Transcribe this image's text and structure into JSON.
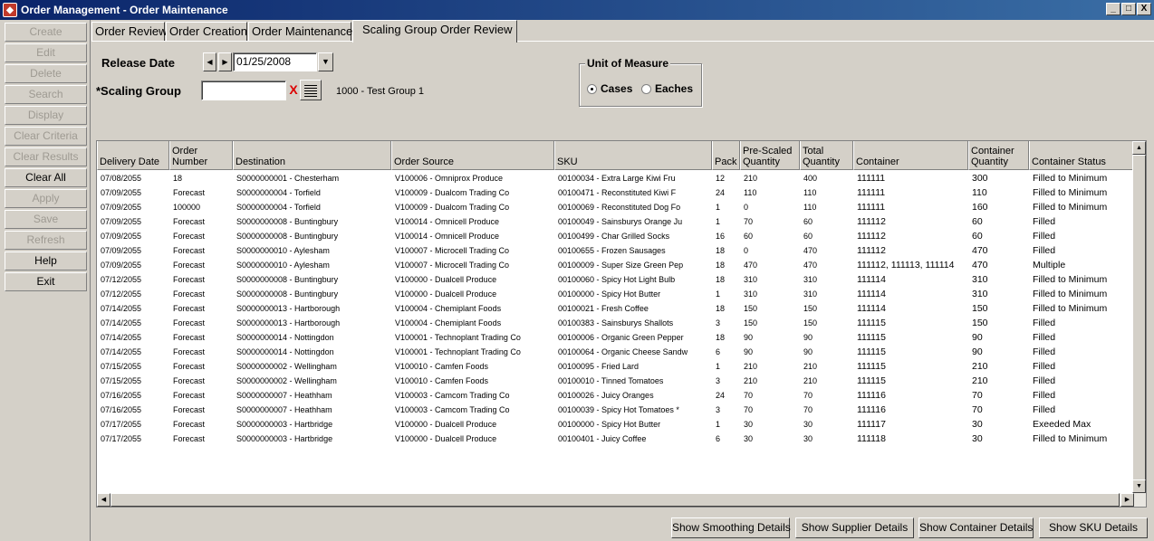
{
  "window": {
    "title": "Order Management - Order Maintenance",
    "controls": [
      "_",
      "□",
      "X"
    ]
  },
  "sidebar": {
    "buttons": [
      {
        "label": "Create",
        "enabled": false
      },
      {
        "label": "Edit",
        "enabled": false
      },
      {
        "label": "Delete",
        "enabled": false
      },
      {
        "label": "Search",
        "enabled": false
      },
      {
        "label": "Display",
        "enabled": false
      },
      {
        "label": "Clear Criteria",
        "enabled": false
      },
      {
        "label": "Clear Results",
        "enabled": false
      },
      {
        "label": "Clear All",
        "enabled": true
      },
      {
        "label": "Apply",
        "enabled": false
      },
      {
        "label": "Save",
        "enabled": false
      },
      {
        "label": "Refresh",
        "enabled": false
      },
      {
        "label": "Help",
        "enabled": true
      },
      {
        "label": "Exit",
        "enabled": true
      }
    ]
  },
  "tabs": [
    {
      "label": "Order Review"
    },
    {
      "label": "Order Creation"
    },
    {
      "label": "Order Maintenance"
    },
    {
      "label": "Scaling Group Order Review",
      "active": true
    }
  ],
  "criteria": {
    "release_date_label": "Release Date",
    "release_date_value": "01/25/2008",
    "scaling_group_label": "*Scaling Group",
    "scaling_group_value": "",
    "scaling_group_desc": "1000 - Test Group 1",
    "uom_label": "Unit of Measure",
    "uom_options": [
      "Cases",
      "Eaches"
    ],
    "uom_selected": "Cases"
  },
  "table": {
    "columns": [
      [
        "Delivery Date"
      ],
      [
        "Order",
        "Number"
      ],
      [
        "Destination"
      ],
      [
        "Order Source"
      ],
      [
        "SKU"
      ],
      [
        "Pack"
      ],
      [
        "Pre-Scaled",
        "Quantity"
      ],
      [
        "Total",
        "Quantity"
      ],
      [
        "Container"
      ],
      [
        "Container",
        "Quantity"
      ],
      [
        "Container Status"
      ]
    ],
    "rows": [
      [
        "07/08/2055",
        "18",
        "S0000000001 - Chesterham",
        "V100006 - Omniprox Produce",
        "00100034 - Extra Large Kiwi Fru",
        "12",
        "210",
        "400",
        "111111",
        "300",
        "Filled to Minimum"
      ],
      [
        "07/09/2055",
        "Forecast",
        "S0000000004 - Torfield",
        "V100009 - Dualcom Trading Co",
        "00100471 - Reconstituted Kiwi F",
        "24",
        "110",
        "110",
        "111111",
        "110",
        "Filled to Minimum"
      ],
      [
        "07/09/2055",
        "100000",
        "S0000000004 - Torfield",
        "V100009 - Dualcom Trading Co",
        "00100069 - Reconstituted Dog Fo",
        "1",
        "0",
        "110",
        "111111",
        "160",
        "Filled to Minimum"
      ],
      [
        "07/09/2055",
        "Forecast",
        "S0000000008 - Buntingbury",
        "V100014 - Omnicell Produce",
        "00100049 - Sainsburys Orange Ju",
        "1",
        "70",
        "60",
        "111112",
        "60",
        "Filled"
      ],
      [
        "07/09/2055",
        "Forecast",
        "S0000000008 - Buntingbury",
        "V100014 - Omnicell Produce",
        "00100499 - Char Grilled Socks",
        "16",
        "60",
        "60",
        "111112",
        "60",
        "Filled"
      ],
      [
        "07/09/2055",
        "Forecast",
        "S0000000010 - Aylesham",
        "V100007 - Microcell Trading Co",
        "00100655 - Frozen Sausages",
        "18",
        "0",
        "470",
        "111112",
        "470",
        "Filled"
      ],
      [
        "07/09/2055",
        "Forecast",
        "S0000000010 - Aylesham",
        "V100007 - Microcell Trading Co",
        "00100009 - Super Size Green Pep",
        "18",
        "470",
        "470",
        "111112,  111113,  111114",
        "470",
        "Multiple"
      ],
      [
        "07/12/2055",
        "Forecast",
        "S0000000008 - Buntingbury",
        "V100000 - Dualcell Produce",
        "00100060 - Spicy Hot Light Bulb",
        "18",
        "310",
        "310",
        "111114",
        "310",
        "Filled to Minimum"
      ],
      [
        "07/12/2055",
        "Forecast",
        "S0000000008 - Buntingbury",
        "V100000 - Dualcell Produce",
        "00100000 - Spicy Hot Butter",
        "1",
        "310",
        "310",
        "111114",
        "310",
        "Filled to Minimum"
      ],
      [
        "07/14/2055",
        "Forecast",
        "S0000000013 - Hartborough",
        "V100004 - Chemiplant Foods",
        "00100021 - Fresh Coffee",
        "18",
        "150",
        "150",
        "111114",
        "150",
        "Filled to Minimum"
      ],
      [
        "07/14/2055",
        "Forecast",
        "S0000000013 - Hartborough",
        "V100004 - Chemiplant Foods",
        "00100383 - Sainsburys Shallots",
        "3",
        "150",
        "150",
        "111115",
        "150",
        "Filled"
      ],
      [
        "07/14/2055",
        "Forecast",
        "S0000000014 - Nottingdon",
        "V100001 - Technoplant Trading Co",
        "00100006 - Organic Green Pepper",
        "18",
        "90",
        "90",
        "111115",
        "90",
        "Filled"
      ],
      [
        "07/14/2055",
        "Forecast",
        "S0000000014 - Nottingdon",
        "V100001 - Technoplant Trading Co",
        "00100064 - Organic Cheese Sandw",
        "6",
        "90",
        "90",
        "111115",
        "90",
        "Filled"
      ],
      [
        "07/15/2055",
        "Forecast",
        "S0000000002 - Wellingham",
        "V100010 - Camfen Foods",
        "00100095 - Fried Lard",
        "1",
        "210",
        "210",
        "111115",
        "210",
        "Filled"
      ],
      [
        "07/15/2055",
        "Forecast",
        "S0000000002 - Wellingham",
        "V100010 - Camfen Foods",
        "00100010 - Tinned Tomatoes",
        "3",
        "210",
        "210",
        "111115",
        "210",
        "Filled"
      ],
      [
        "07/16/2055",
        "Forecast",
        "S0000000007 - Heathham",
        "V100003 - Camcom Trading Co",
        "00100026 - Juicy Oranges",
        "24",
        "70",
        "70",
        "111116",
        "70",
        "Filled"
      ],
      [
        "07/16/2055",
        "Forecast",
        "S0000000007 - Heathham",
        "V100003 - Camcom Trading Co",
        "00100039 - Spicy Hot Tomatoes *",
        "3",
        "70",
        "70",
        "111116",
        "70",
        "Filled"
      ],
      [
        "07/17/2055",
        "Forecast",
        "S0000000003 - Hartbridge",
        "V100000 - Dualcell Produce",
        "00100000 - Spicy Hot Butter",
        "1",
        "30",
        "30",
        "111117",
        "30",
        "Exeeded Max"
      ],
      [
        "07/17/2055",
        "Forecast",
        "S0000000003 - Hartbridge",
        "V100000 - Dualcell Produce",
        "00100401 - Juicy Coffee",
        "6",
        "30",
        "30",
        "111118",
        "30",
        "Filled to Minimum"
      ]
    ]
  },
  "bottom_buttons": [
    "Show Smoothing Details",
    "Show Supplier Details",
    "Show Container Details",
    "Show SKU Details"
  ]
}
